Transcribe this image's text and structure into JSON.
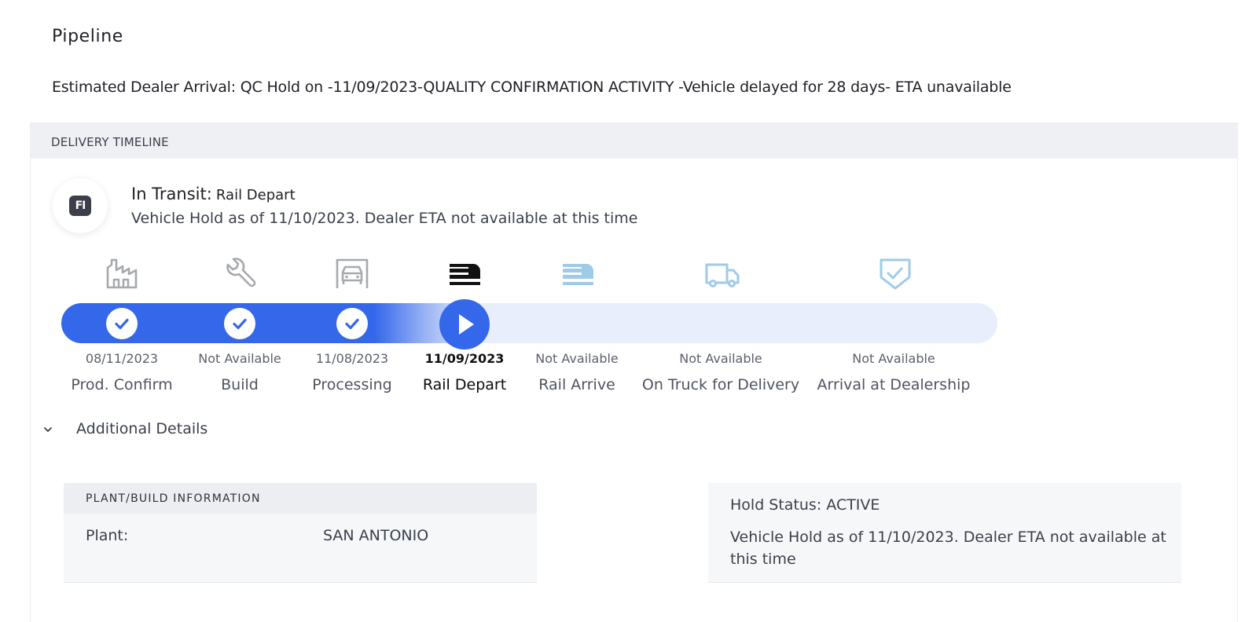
{
  "page": {
    "title": "Pipeline",
    "eta_line": "Estimated Dealer Arrival: QC Hold on -11/09/2023-QUALITY CONFIRMATION ACTIVITY -Vehicle delayed for 28 days- ETA unavailable"
  },
  "timeline": {
    "header": "DELIVERY TIMELINE",
    "status_badge": "FI",
    "status_title": "In Transit:",
    "status_stage": "Rail Depart",
    "status_description": "Vehicle Hold as of 11/10/2023. Dealer ETA not available at this time",
    "progress": 0.44,
    "stages": [
      {
        "name": "Prod. Confirm",
        "date": "08/11/2023",
        "state": "completed",
        "icon": "factory-icon"
      },
      {
        "name": "Build",
        "date": "Not Available",
        "state": "completed",
        "icon": "wrench-icon"
      },
      {
        "name": "Processing",
        "date": "11/08/2023",
        "state": "completed",
        "icon": "car-processing-icon"
      },
      {
        "name": "Rail Depart",
        "date": "11/09/2023",
        "state": "current",
        "icon": "train-icon"
      },
      {
        "name": "Rail Arrive",
        "date": "Not Available",
        "state": "upcoming",
        "icon": "train-icon"
      },
      {
        "name": "On Truck for Delivery",
        "date": "Not Available",
        "state": "upcoming",
        "icon": "truck-icon"
      },
      {
        "name": "Arrival at Dealership",
        "date": "Not Available",
        "state": "upcoming",
        "icon": "shield-check-icon"
      }
    ]
  },
  "details": {
    "toggle_label": "Additional Details",
    "plant_card": {
      "title": "PLANT/BUILD INFORMATION",
      "plant_label": "Plant:",
      "plant_value": "SAN ANTONIO"
    },
    "hold_card": {
      "title": "Hold Status: ACTIVE",
      "description": "Vehicle Hold as of 11/10/2023. Dealer ETA not available at this time"
    }
  },
  "colors": {
    "accent": "#3467ea",
    "track": "#e8eefc",
    "completed_icon": "#a6a9ae",
    "current_icon": "#111111",
    "upcoming_icon": "#9fcbe9"
  }
}
